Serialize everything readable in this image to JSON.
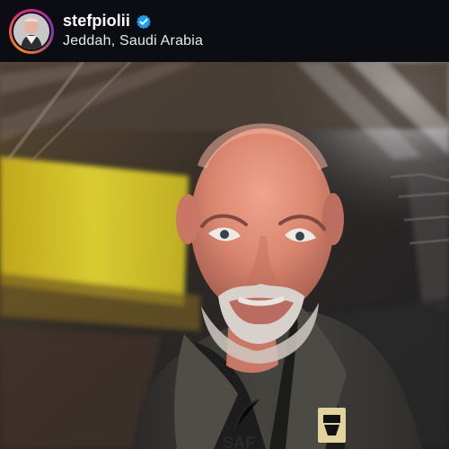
{
  "post": {
    "username": "stefpiolii",
    "location": "Jeddah, Saudi Arabia"
  },
  "icons": {
    "avatar": "profile-avatar",
    "verified": "verified-badge-icon"
  },
  "colors": {
    "header_bg": "#0b0d12",
    "username": "#ffffff",
    "verified": "#1d9bf0",
    "stadium_light": "#f2df2b",
    "jacket": "#3c3b37"
  },
  "photo": {
    "subject": "portrait-photo"
  }
}
